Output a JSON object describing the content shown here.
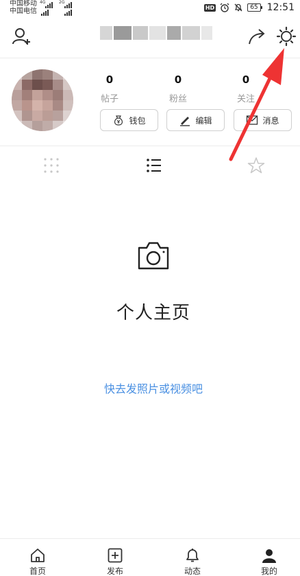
{
  "status_bar": {
    "carrier_1": "中国移动",
    "carrier_2": "中国电信",
    "net_1": "4G",
    "net_2": "2G",
    "badge": "HD",
    "battery": "65",
    "time": "12:51"
  },
  "profile": {
    "stats": [
      {
        "value": "0",
        "label": "帖子"
      },
      {
        "value": "0",
        "label": "粉丝"
      },
      {
        "value": "0",
        "label": "关注"
      }
    ],
    "buttons": {
      "wallet": "钱包",
      "edit": "编辑",
      "message": "消息"
    }
  },
  "empty_state": {
    "title": "个人主页",
    "link": "快去发照片或视频吧"
  },
  "bottom_nav": [
    {
      "label": "首页",
      "icon": "home-icon"
    },
    {
      "label": "发布",
      "icon": "plus-square-icon"
    },
    {
      "label": "动态",
      "icon": "bell-icon"
    },
    {
      "label": "我的",
      "icon": "user-icon"
    }
  ],
  "colors": {
    "link": "#4a90e2",
    "annotation_arrow": "#ee3333"
  }
}
